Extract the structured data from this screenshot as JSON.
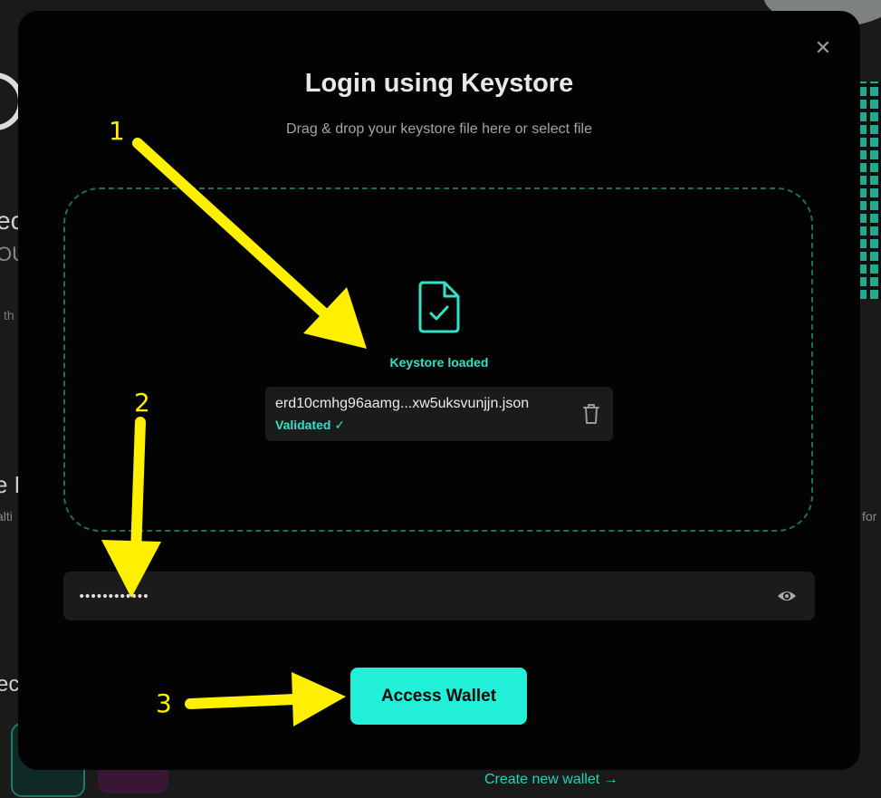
{
  "background": {
    "fragments": [
      "ec",
      "OU",
      "th",
      "e E",
      "alti",
      "for",
      "ec"
    ],
    "create_link": "Create new wallet →"
  },
  "modal": {
    "title": "Login using Keystore",
    "subtitle": "Drag & drop your keystore file here or select file",
    "close_icon": "close-icon",
    "status": "Keystore loaded",
    "file": {
      "name": "erd10cmhg96aamg...xw5uksvunjjn.json",
      "validated_label": "Validated ✓"
    },
    "password": {
      "value": "••••••••••••"
    },
    "access_button": "Access Wallet"
  },
  "annotations": {
    "steps": [
      "1",
      "2",
      "3"
    ],
    "color": "#ffef00"
  },
  "colors": {
    "accent": "#22efd8",
    "modal_bg": "#030303",
    "card_bg": "#1b1b1b"
  }
}
